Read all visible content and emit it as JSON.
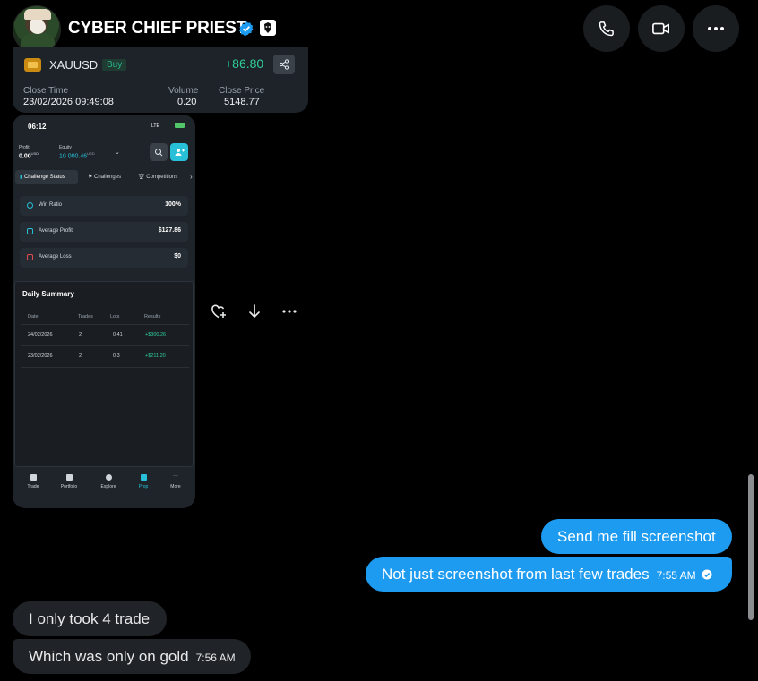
{
  "header": {
    "name": "CYBER CHIEF PRIEST",
    "call_icon": "phone-icon",
    "video_icon": "video-icon",
    "more_icon": "more-horizontal-icon"
  },
  "trade_card": {
    "symbol": "XAUUSD",
    "side": "Buy",
    "pnl": "+86.80",
    "close_time_label": "Close Time",
    "close_time": "23/02/2026 09:49:08",
    "volume_label": "Volume",
    "volume": "0.20",
    "close_price_label": "Close Price",
    "close_price": "5148.77"
  },
  "phone": {
    "time": "06:12",
    "status": "LTE",
    "profit_label": "Profit",
    "profit_value": "0.00",
    "profit_unit": "USD",
    "equity_label": "Equity",
    "equity_value": "10 000.46",
    "equity_unit": "USD",
    "tabs": [
      "Challenge Status",
      "Challenges",
      "Competitions"
    ],
    "stats": [
      {
        "label": "Win Ratio",
        "value": "100%"
      },
      {
        "label": "Average Profit",
        "value": "$127.86"
      },
      {
        "label": "Average Loss",
        "value": "$0"
      }
    ],
    "daily_summary": {
      "title": "Daily Summary",
      "columns": [
        "Date",
        "Trades",
        "Lots",
        "Results"
      ],
      "rows": [
        {
          "date": "24/02/2026",
          "trades": "2",
          "lots": "0.41",
          "result": "+$300.26"
        },
        {
          "date": "23/02/2026",
          "trades": "2",
          "lots": "0.3",
          "result": "+$211.20"
        }
      ]
    },
    "nav": [
      "Trade",
      "Portfolio",
      "Explore",
      "Prop",
      "More"
    ]
  },
  "actions": {
    "react_icon": "add-reaction-icon",
    "download_icon": "download-icon",
    "more_icon": "more-horizontal-icon"
  },
  "messages": {
    "sent": [
      {
        "text": "Send me fill screenshot",
        "time": ""
      },
      {
        "text": "Not just screenshot from last few trades",
        "time": "7:55 AM"
      }
    ],
    "received": [
      {
        "text": "I only took 4 trade",
        "time": ""
      },
      {
        "text": "Which was only on gold",
        "time": "7:56 AM"
      }
    ]
  },
  "colors": {
    "background": "#000000",
    "sent_bubble": "#1d9bf0",
    "received_bubble": "#202327",
    "profit_green": "#2fcf9a",
    "verified_blue": "#1d9bf0"
  }
}
